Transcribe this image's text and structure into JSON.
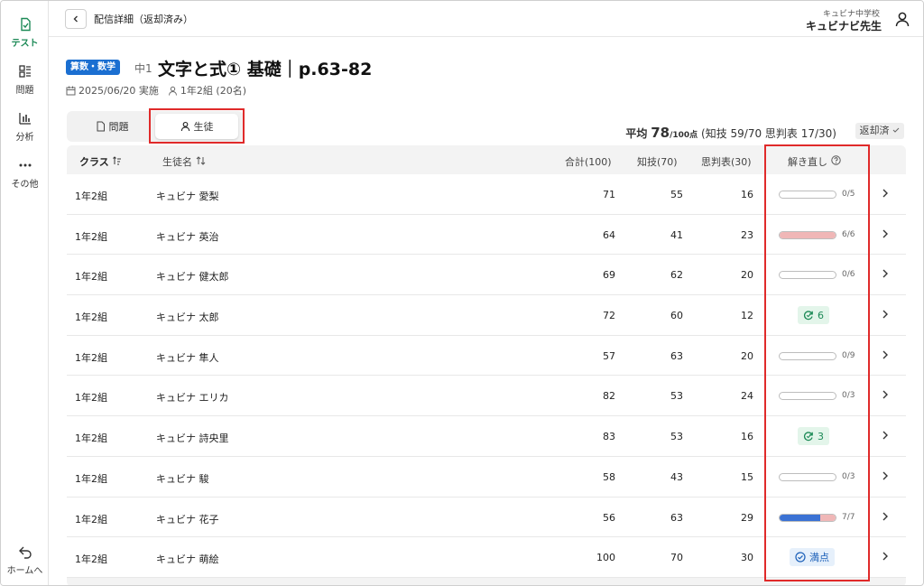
{
  "colors": {
    "accent": "#1d8a57",
    "subject": "#1b6fd1",
    "highlight": "#e02a2a",
    "bar_blue": "#3b72d4",
    "bar_pink": "#f0b7b7"
  },
  "sidebar": {
    "items": [
      {
        "label": "テスト",
        "icon": "test-doc-icon",
        "active": true
      },
      {
        "label": "問題",
        "icon": "questions-grid-icon"
      },
      {
        "label": "分析",
        "icon": "bar-chart-icon"
      },
      {
        "label": "その他",
        "icon": "more-dots-icon"
      }
    ],
    "home_label": "ホームへ"
  },
  "header": {
    "title": "配信詳細（返却済み）",
    "school": "キュビナ中学校",
    "teacher": "キュビナビ先生"
  },
  "test": {
    "subject": "算数・数学",
    "grade": "中1",
    "title": "文字と式① 基礎｜p.63-82",
    "date": "2025/06/20 実施",
    "class_info": "1年2組 (20名)"
  },
  "tabs": [
    {
      "label": "問題"
    },
    {
      "label": "生徒",
      "selected": true
    }
  ],
  "summary": {
    "avg_prefix": "平均",
    "avg_value": "78",
    "avg_unit": "/100点",
    "detail": "(知技 59/70 思判表 17/30)",
    "status": "返却済"
  },
  "table": {
    "headers": {
      "class": "クラス",
      "name": "生徒名",
      "total": "合計(100)",
      "know": "知技(70)",
      "think": "思判表(30)",
      "retry": "解き直し"
    },
    "rows": [
      {
        "class": "1年2組",
        "name": "キュビナ 愛梨",
        "total": "71",
        "know": "55",
        "think": "16",
        "retry_type": "bar",
        "done": 0,
        "of": 5,
        "label": "0/5",
        "blue_fraction": 0,
        "pink_fraction": 0
      },
      {
        "class": "1年2組",
        "name": "キュビナ 英治",
        "total": "64",
        "know": "41",
        "think": "23",
        "retry_type": "bar",
        "done": 6,
        "of": 6,
        "label": "6/6",
        "blue_fraction": 0,
        "pink_fraction": 1
      },
      {
        "class": "1年2組",
        "name": "キュビナ 健太郎",
        "total": "69",
        "know": "62",
        "think": "20",
        "retry_type": "bar",
        "done": 0,
        "of": 6,
        "label": "0/6",
        "blue_fraction": 0,
        "pink_fraction": 0
      },
      {
        "class": "1年2組",
        "name": "キュビナ 太郎",
        "total": "72",
        "know": "60",
        "think": "12",
        "retry_type": "count",
        "count": "6"
      },
      {
        "class": "1年2組",
        "name": "キュビナ 隼人",
        "total": "57",
        "know": "63",
        "think": "20",
        "retry_type": "bar",
        "done": 0,
        "of": 9,
        "label": "0/9",
        "blue_fraction": 0,
        "pink_fraction": 0
      },
      {
        "class": "1年2組",
        "name": "キュビナ エリカ",
        "total": "82",
        "know": "53",
        "think": "24",
        "retry_type": "bar",
        "done": 0,
        "of": 3,
        "label": "0/3",
        "blue_fraction": 0,
        "pink_fraction": 0
      },
      {
        "class": "1年2組",
        "name": "キュビナ 詩央里",
        "total": "83",
        "know": "53",
        "think": "16",
        "retry_type": "count",
        "count": "3"
      },
      {
        "class": "1年2組",
        "name": "キュビナ 駿",
        "total": "58",
        "know": "43",
        "think": "15",
        "retry_type": "bar",
        "done": 0,
        "of": 3,
        "label": "0/3",
        "blue_fraction": 0,
        "pink_fraction": 0
      },
      {
        "class": "1年2組",
        "name": "キュビナ 花子",
        "total": "56",
        "know": "63",
        "think": "29",
        "retry_type": "bar",
        "done": 7,
        "of": 7,
        "label": "7/7",
        "blue_fraction": 0.72,
        "pink_fraction": 0.28
      },
      {
        "class": "1年2組",
        "name": "キュビナ 萌絵",
        "total": "100",
        "know": "70",
        "think": "30",
        "retry_type": "full",
        "full_label": "満点"
      }
    ]
  }
}
